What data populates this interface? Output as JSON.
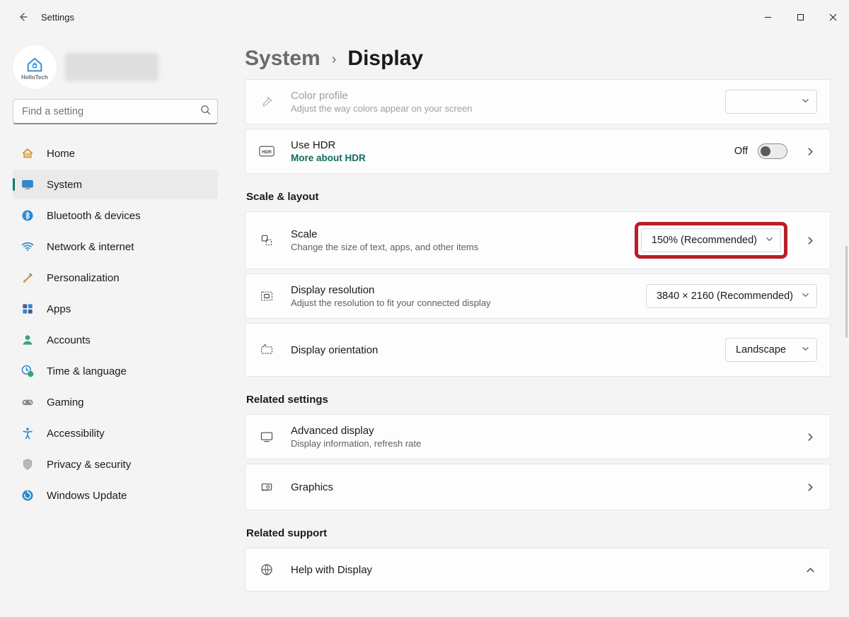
{
  "window": {
    "title": "Settings"
  },
  "account": {
    "avatar_label": "HelloTech"
  },
  "search": {
    "placeholder": "Find a setting"
  },
  "sidebar": {
    "items": [
      {
        "label": "Home"
      },
      {
        "label": "System"
      },
      {
        "label": "Bluetooth & devices"
      },
      {
        "label": "Network & internet"
      },
      {
        "label": "Personalization"
      },
      {
        "label": "Apps"
      },
      {
        "label": "Accounts"
      },
      {
        "label": "Time & language"
      },
      {
        "label": "Gaming"
      },
      {
        "label": "Accessibility"
      },
      {
        "label": "Privacy & security"
      },
      {
        "label": "Windows Update"
      }
    ],
    "selected_index": 1
  },
  "breadcrumb": {
    "parent": "System",
    "current": "Display"
  },
  "cards": {
    "color_profile": {
      "title": "Color profile",
      "subtitle": "Adjust the way colors appear on your screen",
      "value": ""
    },
    "hdr": {
      "title": "Use HDR",
      "link": "More about HDR",
      "toggle_label": "Off",
      "toggle_on": false
    },
    "scale": {
      "title": "Scale",
      "subtitle": "Change the size of text, apps, and other items",
      "value": "150% (Recommended)"
    },
    "resolution": {
      "title": "Display resolution",
      "subtitle": "Adjust the resolution to fit your connected display",
      "value": "3840 × 2160 (Recommended)"
    },
    "orientation": {
      "title": "Display orientation",
      "value": "Landscape"
    },
    "advanced": {
      "title": "Advanced display",
      "subtitle": "Display information, refresh rate"
    },
    "graphics": {
      "title": "Graphics"
    },
    "help": {
      "title": "Help with Display"
    }
  },
  "sections": {
    "scale_layout": "Scale & layout",
    "related_settings": "Related settings",
    "related_support": "Related support"
  }
}
